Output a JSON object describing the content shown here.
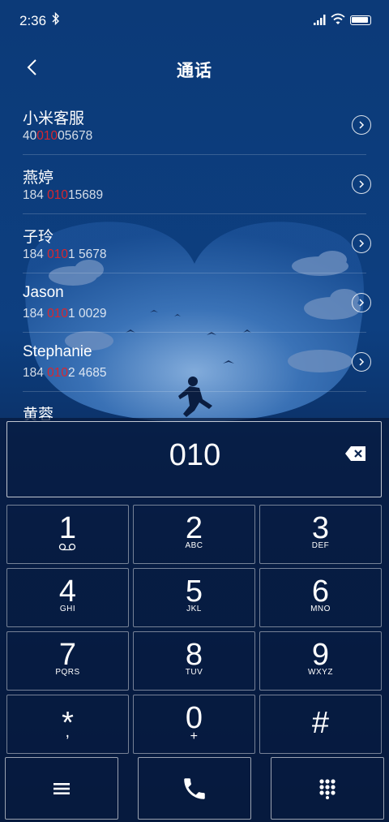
{
  "status_bar": {
    "time": "2:36"
  },
  "header": {
    "title": "通话"
  },
  "contacts": [
    {
      "name": "小米客服",
      "number_pre": "40",
      "number_match": "010",
      "number_post": "05678"
    },
    {
      "name": "燕婷",
      "number_pre": "184 ",
      "number_match": "010",
      "number_post": "15689"
    },
    {
      "name": "子玲",
      "number_pre": "184 ",
      "number_match": "010",
      "number_post": "1 5678"
    },
    {
      "name": "Jason",
      "number_pre": "184 ",
      "number_match": "010",
      "number_post": "1 0029"
    },
    {
      "name": "Stephanie",
      "number_pre": "184 ",
      "number_match": "010",
      "number_post": "2 4685"
    },
    {
      "name": "黄蓉",
      "number_pre": "",
      "number_match": "",
      "number_post": ""
    }
  ],
  "dialer": {
    "entered_number": "010",
    "keys": [
      {
        "digit": "1",
        "letters": ""
      },
      {
        "digit": "2",
        "letters": "ABC"
      },
      {
        "digit": "3",
        "letters": "DEF"
      },
      {
        "digit": "4",
        "letters": "GHI"
      },
      {
        "digit": "5",
        "letters": "JKL"
      },
      {
        "digit": "6",
        "letters": "MNO"
      },
      {
        "digit": "7",
        "letters": "PQRS"
      },
      {
        "digit": "8",
        "letters": "TUV"
      },
      {
        "digit": "9",
        "letters": "WXYZ"
      },
      {
        "digit": "*",
        "letters": ","
      },
      {
        "digit": "0",
        "letters": "+"
      },
      {
        "digit": "#",
        "letters": ""
      }
    ]
  },
  "colors": {
    "match_highlight": "#d9262e",
    "background": "#0c3a78"
  },
  "icons": {
    "back": "chevron-left-icon",
    "detail": "chevron-right-circle-icon",
    "delete": "backspace-icon",
    "menu": "hamburger-icon",
    "call": "phone-icon",
    "dialpad": "keypad-icon",
    "voicemail": "voicemail-icon"
  }
}
